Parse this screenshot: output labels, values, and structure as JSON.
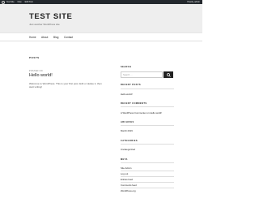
{
  "adminbar": {
    "items": [
      "Test Site",
      "New",
      "Edit Post"
    ],
    "user": "Howdy, admin",
    "bg_color": "#23282d"
  },
  "site": {
    "title": "TEST SITE",
    "tagline": "Just another WordPress site"
  },
  "nav": {
    "items": [
      "Home",
      "About",
      "Blog",
      "Contact"
    ]
  },
  "main": {
    "page_header": "POSTS",
    "post": {
      "meta": "POSTED ON",
      "title": "Hello world!",
      "excerpt": "Welcome to WordPress. This is your first post. Edit or delete it, then start writing!"
    }
  },
  "sidebar": {
    "search_title": "SEARCH",
    "search_placeholder": "Search …",
    "search_icon": "search-icon",
    "recent_posts_title": "RECENT POSTS",
    "recent_posts": [
      "Hello world!"
    ],
    "recent_comments_title": "RECENT COMMENTS",
    "recent_comments": [
      "A WordPress Commenter on Hello world!"
    ],
    "archives_title": "ARCHIVES",
    "archives": [
      "March 2019"
    ],
    "categories_title": "CATEGORIES",
    "categories": [
      "Uncategorized"
    ],
    "meta_title": "META",
    "meta": [
      "Site Admin",
      "Log out",
      "Entries feed",
      "Comments feed",
      "WordPress.org"
    ]
  }
}
